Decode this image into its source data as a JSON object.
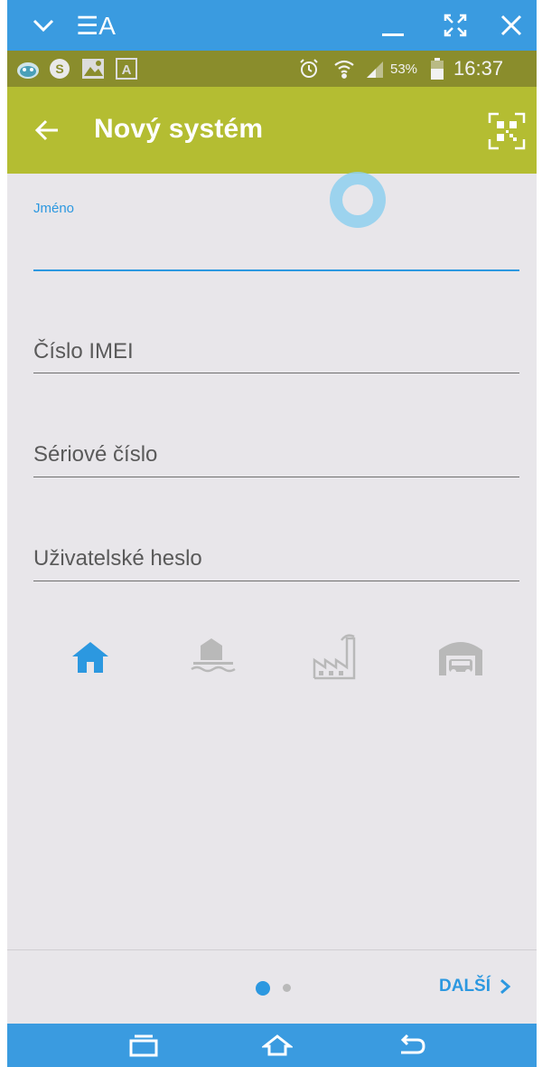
{
  "window_bar": {
    "title": "☰A",
    "icons": [
      "chevron-down-icon",
      "minimize-icon",
      "fullscreen-icon",
      "close-icon"
    ]
  },
  "status_bar": {
    "left_icons": [
      "alien-icon",
      "sync-icon",
      "image-icon",
      "a-icon"
    ],
    "battery_percent": "53%",
    "time": "16:37",
    "right_icons": [
      "alarm-icon",
      "wifi-icon",
      "signal-icon",
      "battery-icon"
    ]
  },
  "app_bar": {
    "title": "Nový systém",
    "back_icon": "arrow-left-icon",
    "action_icon": "qr-scan-icon"
  },
  "form": {
    "name": {
      "label": "Jméno",
      "value": ""
    },
    "imei": {
      "placeholder": "Číslo IMEI"
    },
    "serial": {
      "placeholder": "Sériové číslo"
    },
    "password": {
      "placeholder": "Uživatelské heslo"
    }
  },
  "system_types": [
    {
      "icon": "house-icon",
      "selected": true
    },
    {
      "icon": "cottage-water-icon",
      "selected": false
    },
    {
      "icon": "factory-icon",
      "selected": false
    },
    {
      "icon": "garage-icon",
      "selected": false
    }
  ],
  "pager": {
    "current": 1,
    "total": 2
  },
  "footer": {
    "next_label": "DALŠÍ"
  },
  "colors": {
    "window_bar": "#3a9be0",
    "status_bar": "#8a8d2c",
    "app_bar": "#b4bd32",
    "accent": "#2c98e0",
    "background": "#e8e6ea",
    "inactive_icon": "#b9b9b9"
  }
}
